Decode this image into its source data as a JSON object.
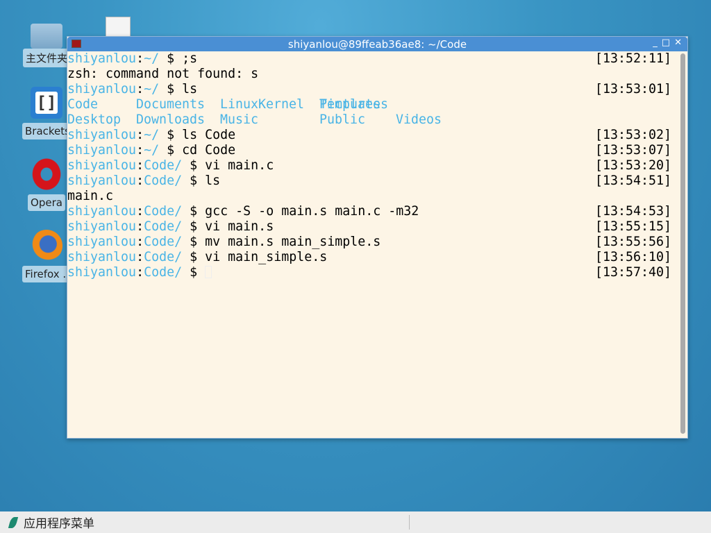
{
  "desktop": {
    "icons": [
      {
        "label": "主文件夹",
        "icon": "home-folder-icon"
      },
      {
        "label": "Brackets",
        "icon": "brackets-icon"
      },
      {
        "label": "Opera",
        "icon": "opera-icon"
      },
      {
        "label": "Firefox ...",
        "icon": "firefox-icon"
      }
    ]
  },
  "window": {
    "title": "shiyanlou@89ffeab36ae8: ~/Code",
    "controls": {
      "minimize": "_",
      "maximize": "□",
      "close": "✕"
    }
  },
  "terminal": {
    "colors": {
      "prompt": "#49b4e6",
      "text": "#000000",
      "background": "#fdf5e6"
    },
    "lines": [
      {
        "user": "shiyanlou",
        "path": "~/",
        "cmd": ";s",
        "time": "[13:52:11]"
      },
      {
        "out": "zsh: command not found: s"
      },
      {
        "user": "shiyanlou",
        "path": "~/",
        "cmd": "ls",
        "time": "[13:53:01]"
      },
      {
        "ls": [
          "Code",
          "Documents",
          "LinuxKernel",
          "Pictures",
          "Templates"
        ]
      },
      {
        "ls": [
          "Desktop",
          "Downloads",
          "Music",
          "",
          "Public",
          "Videos"
        ]
      },
      {
        "user": "shiyanlou",
        "path": "~/",
        "cmd": "ls Code",
        "time": "[13:53:02]"
      },
      {
        "user": "shiyanlou",
        "path": "~/",
        "cmd": "cd Code",
        "time": "[13:53:07]"
      },
      {
        "user": "shiyanlou",
        "path": "Code/",
        "cmd": "vi main.c",
        "time": "[13:53:20]"
      },
      {
        "user": "shiyanlou",
        "path": "Code/",
        "cmd": "ls",
        "time": "[13:54:51]"
      },
      {
        "out": "main.c"
      },
      {
        "user": "shiyanlou",
        "path": "Code/",
        "cmd": "gcc -S -o main.s main.c -m32",
        "time": "[13:54:53]"
      },
      {
        "user": "shiyanlou",
        "path": "Code/",
        "cmd": "vi main.s",
        "time": "[13:55:15]"
      },
      {
        "user": "shiyanlou",
        "path": "Code/",
        "cmd": "mv main.s main_simple.s",
        "time": "[13:55:56]"
      },
      {
        "user": "shiyanlou",
        "path": "Code/",
        "cmd": "vi main_simple.s",
        "time": "[13:56:10]"
      },
      {
        "user": "shiyanlou",
        "path": "Code/",
        "cmd": "",
        "time": "[13:57:40]",
        "cursor": true
      }
    ]
  },
  "taskbar": {
    "menu_label": "应用程序菜单"
  }
}
